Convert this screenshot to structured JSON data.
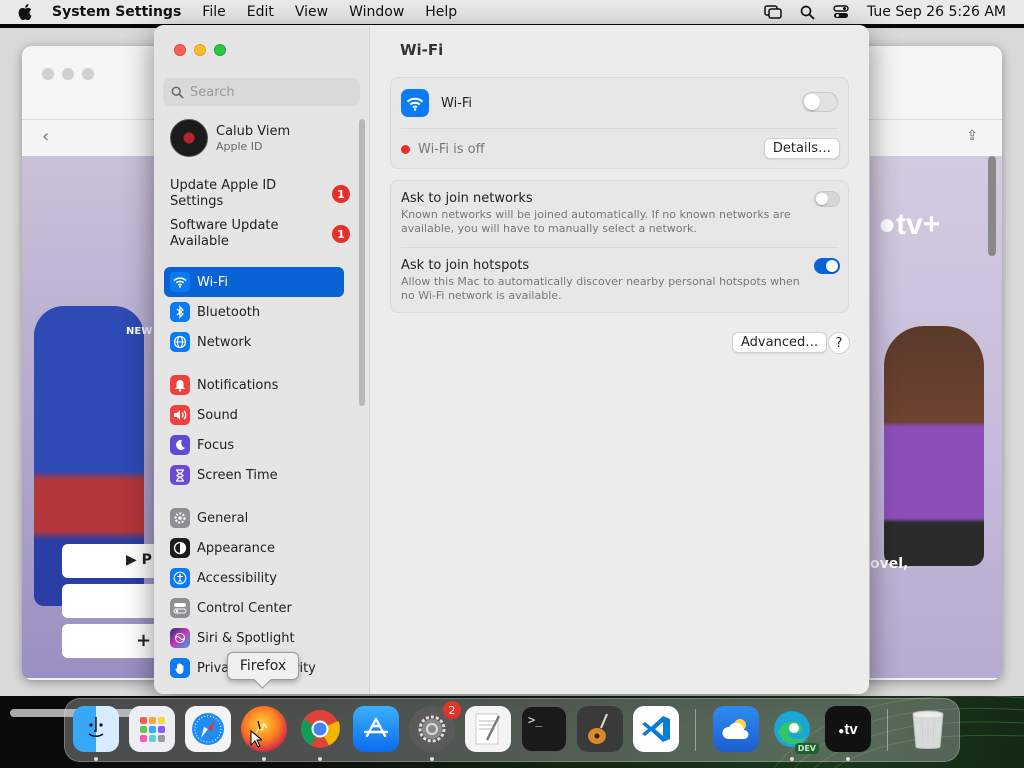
{
  "menubar": {
    "app_name": "System Settings",
    "menus": [
      "File",
      "Edit",
      "View",
      "Window",
      "Help"
    ],
    "clock": "Tue Sep 26  5:26 AM"
  },
  "background_window": {
    "text_new": "NEW",
    "text_novel": "ovel,",
    "tv_logo": "tv+",
    "button_play_glyph": "▶ P",
    "button_add_glyph": "+"
  },
  "settings": {
    "search_placeholder": "Search",
    "account": {
      "name": "Calub Viem",
      "subtitle": "Apple ID"
    },
    "notices": [
      {
        "label": "Update Apple ID Settings",
        "badge": "1"
      },
      {
        "label": "Software Update Available",
        "badge": "1"
      }
    ],
    "nav_group1": [
      {
        "label": "Wi-Fi",
        "icon": "wifi-icon",
        "color": "#0a7bf5",
        "active": true
      },
      {
        "label": "Bluetooth",
        "icon": "bluetooth-icon",
        "color": "#0a7bf5",
        "active": false
      },
      {
        "label": "Network",
        "icon": "globe-icon",
        "color": "#0a7bf5",
        "active": false
      }
    ],
    "nav_group2": [
      {
        "label": "Notifications",
        "icon": "bell-icon",
        "color": "#f0413f"
      },
      {
        "label": "Sound",
        "icon": "speaker-icon",
        "color": "#f0413f"
      },
      {
        "label": "Focus",
        "icon": "moon-icon",
        "color": "#5e4bd6"
      },
      {
        "label": "Screen Time",
        "icon": "hourglass-icon",
        "color": "#6a4bd6"
      }
    ],
    "nav_group3": [
      {
        "label": "General",
        "icon": "gear-icon",
        "color": "#8e8e93"
      },
      {
        "label": "Appearance",
        "icon": "appearance-icon",
        "color": "#1c1c1e"
      },
      {
        "label": "Accessibility",
        "icon": "accessibility-icon",
        "color": "#0a7bf5"
      },
      {
        "label": "Control Center",
        "icon": "control-center-icon",
        "color": "#8e8e93"
      },
      {
        "label": "Siri & Spotlight",
        "icon": "siri-icon",
        "color": "#2b2b7a"
      },
      {
        "label": "Privacy & Security",
        "icon": "hand-icon",
        "color": "#0a7bf5"
      }
    ],
    "main": {
      "title": "Wi-Fi",
      "wifi_label": "Wi-Fi",
      "wifi_on": false,
      "status_text": "Wi-Fi is off",
      "status_color": "#e8302b",
      "details_button": "Details…",
      "ask_networks_title": "Ask to join networks",
      "ask_networks_desc": "Known networks will be joined automatically. If no known networks are available, you will have to manually select a network.",
      "ask_networks_on": false,
      "ask_hotspots_title": "Ask to join hotspots",
      "ask_hotspots_desc": "Allow this Mac to automatically discover nearby personal hotspots when no Wi-Fi network is available.",
      "ask_hotspots_on": true,
      "advanced_button": "Advanced…",
      "help_button": "?"
    }
  },
  "tooltip": "Firefox",
  "dock": {
    "items": [
      {
        "name": "finder-icon",
        "running": true
      },
      {
        "name": "launchpad-icon",
        "running": false
      },
      {
        "name": "safari-icon",
        "running": false
      },
      {
        "name": "firefox-icon",
        "running": true
      },
      {
        "name": "chrome-icon",
        "running": true
      },
      {
        "name": "app-store-icon",
        "running": false
      },
      {
        "name": "system-settings-icon",
        "running": true,
        "badge": "2"
      },
      {
        "name": "textedit-icon",
        "running": false
      },
      {
        "name": "terminal-icon",
        "running": false
      },
      {
        "name": "garageband-icon",
        "running": false
      },
      {
        "name": "vscode-icon",
        "running": false
      },
      {
        "name": "weather-icon",
        "running": false
      },
      {
        "name": "edge-dev-icon",
        "running": true,
        "tag": "DEV"
      },
      {
        "name": "apple-tv-icon",
        "running": true
      },
      {
        "name": "trash-icon",
        "running": false
      }
    ],
    "terminal_prompt": ">_",
    "appletv_label": "tv"
  }
}
